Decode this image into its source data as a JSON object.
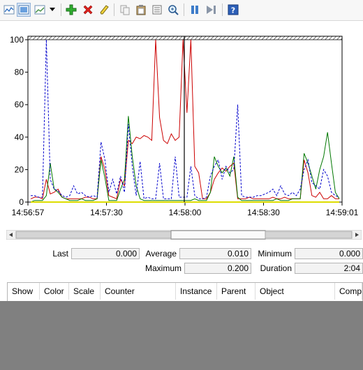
{
  "toolbar": {
    "buttons": [
      {
        "name": "view-graph-icon",
        "pressed": false
      },
      {
        "name": "view-histogram-icon",
        "pressed": true
      },
      {
        "name": "view-report-icon",
        "pressed": false
      },
      {
        "name": "add-counter-icon"
      },
      {
        "name": "delete-counter-icon"
      },
      {
        "name": "highlight-icon"
      },
      {
        "name": "copy-properties-icon"
      },
      {
        "name": "paste-counter-list-icon"
      },
      {
        "name": "properties-icon"
      },
      {
        "name": "zoom-icon"
      },
      {
        "name": "freeze-display-icon"
      },
      {
        "name": "update-data-icon"
      },
      {
        "name": "help-icon"
      }
    ]
  },
  "chart_data": {
    "type": "line",
    "ylim": [
      0,
      100
    ],
    "yticks": [
      "100",
      "80",
      "60",
      "40",
      "20",
      "0"
    ],
    "xticks": [
      "14:56:57",
      "14:57:30",
      "14:58:00",
      "14:58:30",
      "14:59:01"
    ],
    "grid": false,
    "series": [
      {
        "color": "#cc0000",
        "style": "solid",
        "values": [
          2,
          3,
          3,
          2,
          14,
          5,
          6,
          8,
          3,
          2,
          2,
          2,
          2,
          2,
          3,
          3,
          2,
          2,
          28,
          20,
          4,
          3,
          2,
          14,
          10,
          38,
          36,
          40,
          39,
          41,
          40,
          38,
          100,
          52,
          38,
          36,
          42,
          38,
          40,
          100,
          55,
          100,
          22,
          18,
          2,
          2,
          6,
          14,
          18,
          21,
          19,
          22,
          24,
          2,
          2,
          2,
          3,
          2,
          2,
          2,
          2,
          2,
          3,
          2,
          2,
          3,
          2,
          2,
          2,
          2,
          26,
          18,
          4,
          3,
          6,
          2,
          2,
          4,
          2,
          2
        ]
      },
      {
        "color": "#007700",
        "style": "solid",
        "values": [
          0,
          1,
          1,
          1,
          4,
          24,
          8,
          6,
          3,
          2,
          1,
          1,
          1,
          2,
          1,
          1,
          1,
          2,
          26,
          15,
          1,
          1,
          1,
          8,
          14,
          53,
          28,
          10,
          2,
          1,
          1,
          1,
          1,
          1,
          1,
          1,
          1,
          1,
          1,
          1,
          1,
          1,
          2,
          1,
          1,
          1,
          6,
          28,
          22,
          18,
          21,
          16,
          28,
          3,
          1,
          1,
          1,
          1,
          1,
          1,
          1,
          1,
          1,
          2,
          1,
          1,
          1,
          2,
          2,
          2,
          30,
          24,
          16,
          8,
          20,
          28,
          43,
          24,
          6,
          2
        ]
      },
      {
        "color": "#0000cc",
        "style": "dashed",
        "values": [
          4,
          4,
          3,
          3,
          100,
          14,
          8,
          7,
          4,
          3,
          4,
          10,
          5,
          6,
          4,
          3,
          4,
          3,
          37,
          26,
          6,
          14,
          5,
          16,
          6,
          48,
          22,
          4,
          25,
          2,
          3,
          2,
          2,
          24,
          2,
          2,
          2,
          28,
          3,
          3,
          3,
          22,
          4,
          2,
          2,
          3,
          16,
          22,
          26,
          14,
          22,
          18,
          20,
          60,
          4,
          3,
          3,
          3,
          4,
          4,
          5,
          6,
          8,
          4,
          10,
          5,
          4,
          6,
          4,
          8,
          20,
          26,
          12,
          10,
          8,
          20,
          16,
          6,
          4,
          3
        ]
      },
      {
        "color": "#dddd00",
        "style": "solid",
        "values": [
          0,
          0,
          0,
          0,
          0,
          0,
          0,
          0,
          0,
          0,
          0,
          0,
          0,
          0,
          0,
          0,
          0,
          0,
          0,
          0,
          0,
          0,
          0,
          0,
          0,
          0,
          0,
          0,
          0,
          0,
          0,
          0,
          0,
          0,
          0,
          0,
          0,
          0,
          0,
          0,
          0,
          0,
          0,
          0,
          0,
          0,
          0,
          0,
          0,
          0,
          0,
          0,
          0,
          0,
          0,
          0,
          0,
          0,
          0,
          0,
          0,
          0,
          0,
          0,
          0,
          0,
          0,
          0,
          0,
          0,
          0,
          0,
          0,
          0,
          0,
          0,
          0,
          0,
          0,
          0
        ]
      }
    ]
  },
  "stats": {
    "last_label": "Last",
    "last_value": "0.000",
    "average_label": "Average",
    "average_value": "0.010",
    "minimum_label": "Minimum",
    "minimum_value": "0.000",
    "maximum_label": "Maximum",
    "maximum_value": "0.200",
    "duration_label": "Duration",
    "duration_value": "2:04"
  },
  "scrollbar": {
    "value": 0.62
  },
  "legend": {
    "columns": [
      "Show",
      "Color",
      "Scale",
      "Counter",
      "Instance",
      "Parent",
      "Object",
      "Computer"
    ]
  }
}
